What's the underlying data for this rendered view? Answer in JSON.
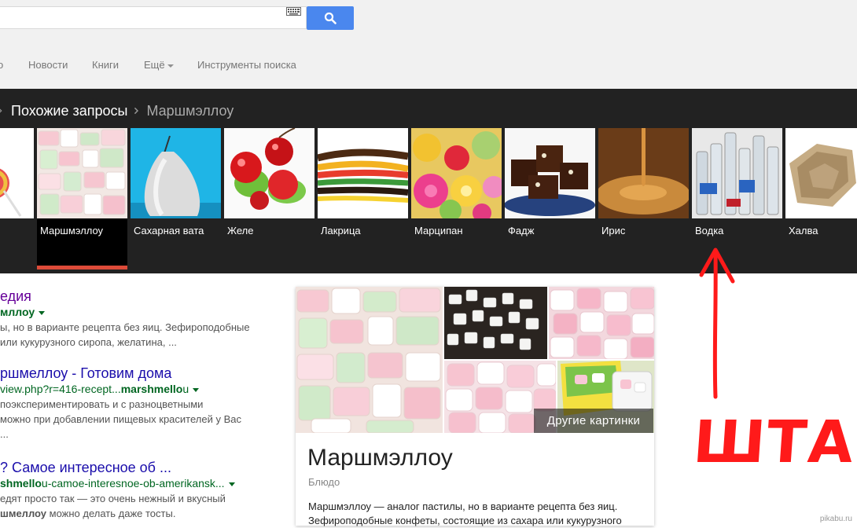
{
  "header": {
    "tabs": [
      {
        "label": "о"
      },
      {
        "label": "Новости"
      },
      {
        "label": "Книги"
      },
      {
        "label": "Ещё"
      },
      {
        "label": "Инструменты поиска"
      }
    ]
  },
  "carousel": {
    "breadcrumb": {
      "parent": "Похожие запросы",
      "current": "Маршмэллоу"
    },
    "items": [
      {
        "label": ""
      },
      {
        "label": "Маршмэллоу",
        "selected": true
      },
      {
        "label": "Сахарная вата"
      },
      {
        "label": "Желе"
      },
      {
        "label": "Лакрица"
      },
      {
        "label": "Марципан"
      },
      {
        "label": "Фадж"
      },
      {
        "label": "Ирис"
      },
      {
        "label": "Водка"
      },
      {
        "label": "Халва"
      }
    ]
  },
  "results": [
    {
      "title": "едия",
      "url_pre": "",
      "url_bold": "мллоу",
      "url_post": "",
      "snippet": [
        "ы, но в варианте рецепта без яиц. Зефироподобные",
        "или кукурузного сиропа, желатина, ..."
      ]
    },
    {
      "title": "ршмеллоу - Готовим дома",
      "url_pre": "view.php?r=416-recept...",
      "url_bold": "marshmello",
      "url_post": "u",
      "snippet": [
        "поэкспериментировать и с разноцветными",
        "можно при добавлении пищевых красителей у Вас",
        "..."
      ]
    },
    {
      "title": "? Самое интересное об ...",
      "url_pre": "",
      "url_bold": "shmello",
      "url_post": "u-camoe-interesnoe-ob-amerikansk...",
      "snippet_1a": "едят просто так — это очень нежный и вкусный",
      "snippet_2a": "шмеллоу",
      "snippet_2b": " можно делать даже тосты."
    }
  ],
  "knowledge_panel": {
    "title": "Маршмэллоу",
    "type": "Блюдо",
    "more_images": "Другие картинки",
    "description": [
      "Маршмэллоу — аналог пастилы, но в варианте рецепта без яиц.",
      "Зефироподобные конфеты, состоящие из сахара или кукурузного"
    ]
  },
  "annotation": {
    "text": "ШТА?",
    "color": "#ff0000"
  },
  "watermark": "pikabu.ru",
  "colors": {
    "search_button": "#4a87ee",
    "selected_bar": "#dd4b39",
    "link": "#1a0dab",
    "url": "#006621"
  }
}
